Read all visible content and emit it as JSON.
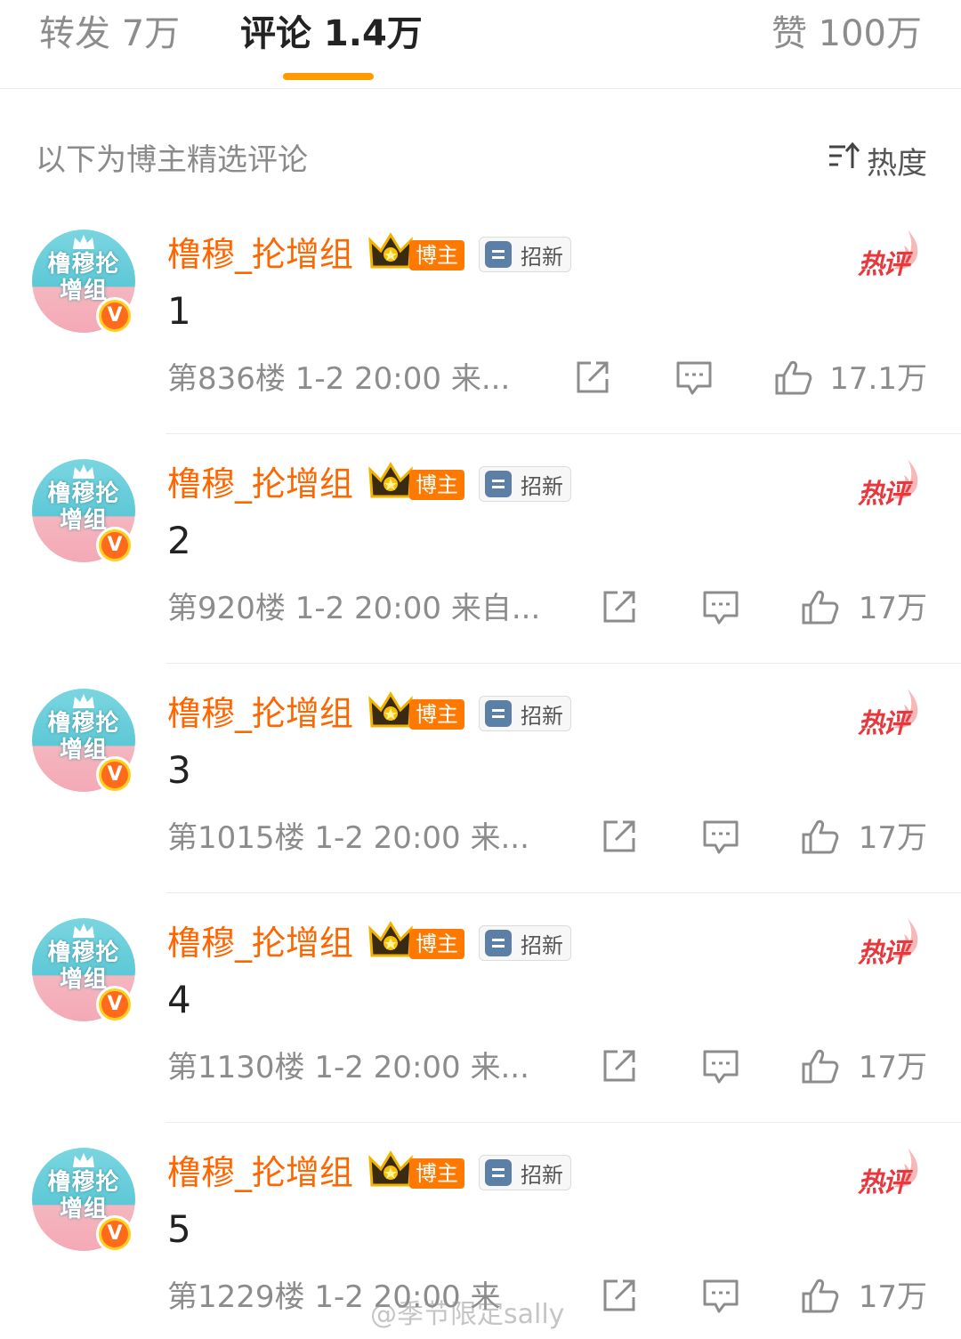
{
  "tabs": {
    "repost": "转发 7万",
    "comments": "评论 1.4万",
    "likes": "赞 100万"
  },
  "subheader": {
    "note": "以下为博主精选评论",
    "sort_label": "热度"
  },
  "comments": [
    {
      "username": "橹穆_抡增组",
      "blogger_tag": "博主",
      "recruit_tag": "招新",
      "hot_label": "热评",
      "content": "1",
      "meta": "第836楼 1-2 20:00 来...",
      "likes": "17.1万"
    },
    {
      "username": "橹穆_抡增组",
      "blogger_tag": "博主",
      "recruit_tag": "招新",
      "hot_label": "热评",
      "content": "2",
      "meta": "第920楼 1-2 20:00 来自...",
      "likes": "17万"
    },
    {
      "username": "橹穆_抡增组",
      "blogger_tag": "博主",
      "recruit_tag": "招新",
      "hot_label": "热评",
      "content": "3",
      "meta": "第1015楼 1-2 20:00 来...",
      "likes": "17万"
    },
    {
      "username": "橹穆_抡增组",
      "blogger_tag": "博主",
      "recruit_tag": "招新",
      "hot_label": "热评",
      "content": "4",
      "meta": "第1130楼 1-2 20:00 来...",
      "likes": "17万"
    },
    {
      "username": "橹穆_抡增组",
      "blogger_tag": "博主",
      "recruit_tag": "招新",
      "hot_label": "热评",
      "content": "5",
      "meta": "第1229楼 1-2 20:00 来",
      "likes": "17万"
    }
  ],
  "avatar_text": "橹穆抡增组",
  "watermark": "@季节限定sally",
  "colors": {
    "accent": "#ff9b00",
    "username": "#ff6600",
    "blogger_tag": "#ff7900",
    "hot": "#e8383d"
  },
  "icons": {
    "sort": "sort-icon",
    "repost": "repost-icon",
    "reply": "comment-icon",
    "like": "thumbs-up-icon"
  }
}
